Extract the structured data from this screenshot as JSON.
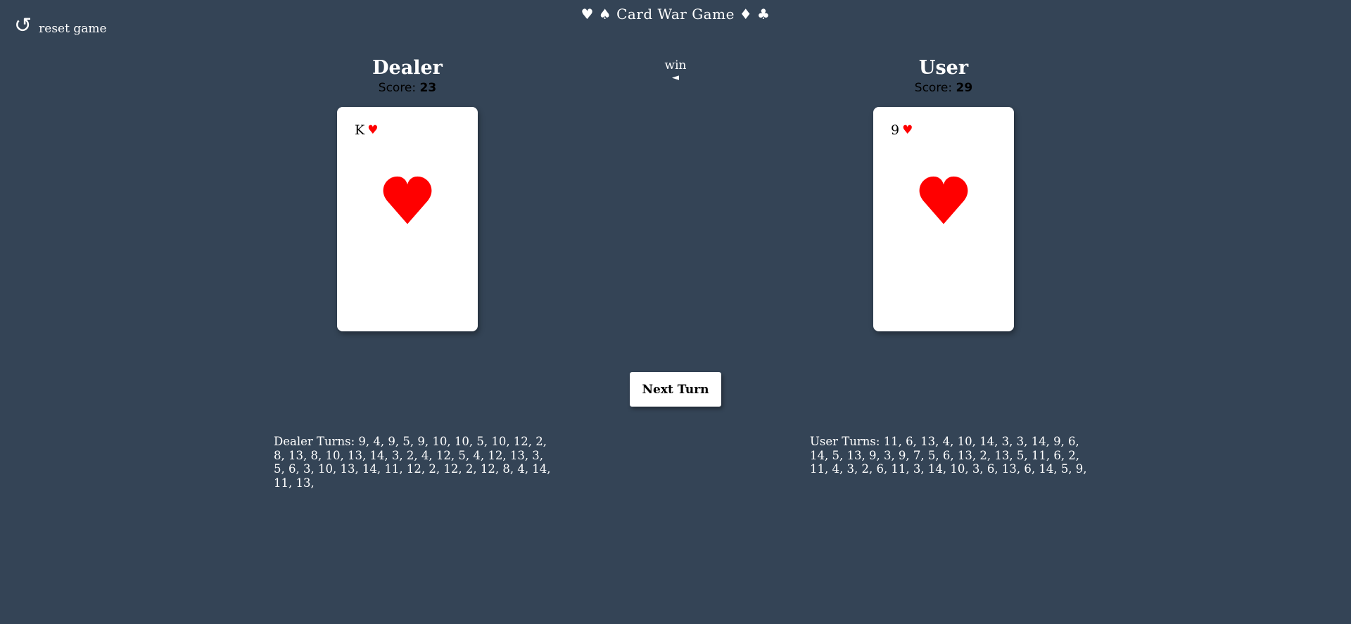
{
  "header": {
    "title": "♥ ♠ Card War Game ♦ ♣",
    "reset_icon": "↺",
    "reset_label": "reset game"
  },
  "dealer": {
    "name": "Dealer",
    "score_label": "Score: ",
    "score": "23",
    "card": {
      "rank": "K",
      "suit": "♥",
      "suit_name": "hearts",
      "suit_color": "#ff0000"
    },
    "turns_text": "Dealer Turns: 9, 4, 9, 5, 9, 10, 10, 5, 10, 12, 2, 8, 13, 8, 10, 13, 14, 3, 2, 4, 12, 5, 4, 12, 13, 3, 5, 6, 3, 10, 13, 14, 11, 12, 2, 12, 2, 12, 8, 4, 14, 11, 13,"
  },
  "user": {
    "name": "User",
    "score_label": "Score: ",
    "score": "29",
    "card": {
      "rank": "9",
      "suit": "♥",
      "suit_name": "hearts",
      "suit_color": "#ff0000"
    },
    "turns_text": "User Turns: 11, 6, 13, 4, 10, 14, 3, 3, 14, 9, 6, 14, 5, 13, 9, 3, 9, 7, 5, 6, 13, 2, 13, 5, 11, 6, 2, 11, 4, 3, 2, 6, 11, 3, 14, 10, 3, 6, 13, 6, 14, 5, 9,"
  },
  "result": {
    "label": "win",
    "arrow": "◄",
    "winner": "dealer"
  },
  "controls": {
    "next_turn_label": "Next Turn"
  },
  "colors": {
    "background": "#344456",
    "text": "#ffffff",
    "card": "#ffffff",
    "heart": "#ff0000"
  }
}
